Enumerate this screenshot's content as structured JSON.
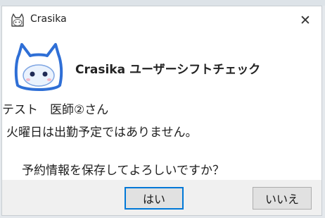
{
  "window": {
    "title": "Crasika",
    "close_label": "✕"
  },
  "message": {
    "app_heading": "Crasika ユーザーシフトチェック",
    "line1": "テスト　医師②さん",
    "line2": "火曜日は出勤予定ではありません。",
    "line3": "予約情報を保存してよろしいですか？"
  },
  "buttons": {
    "yes": "はい",
    "no": "いいえ"
  },
  "icons": {
    "title_icon": "cat-outline-icon",
    "mascot": "crasika-mascot-icon",
    "close": "close-icon"
  },
  "colors": {
    "mascot_blue": "#2f6fd6",
    "accent": "#0078d7",
    "footer": "#f0f0f0"
  }
}
